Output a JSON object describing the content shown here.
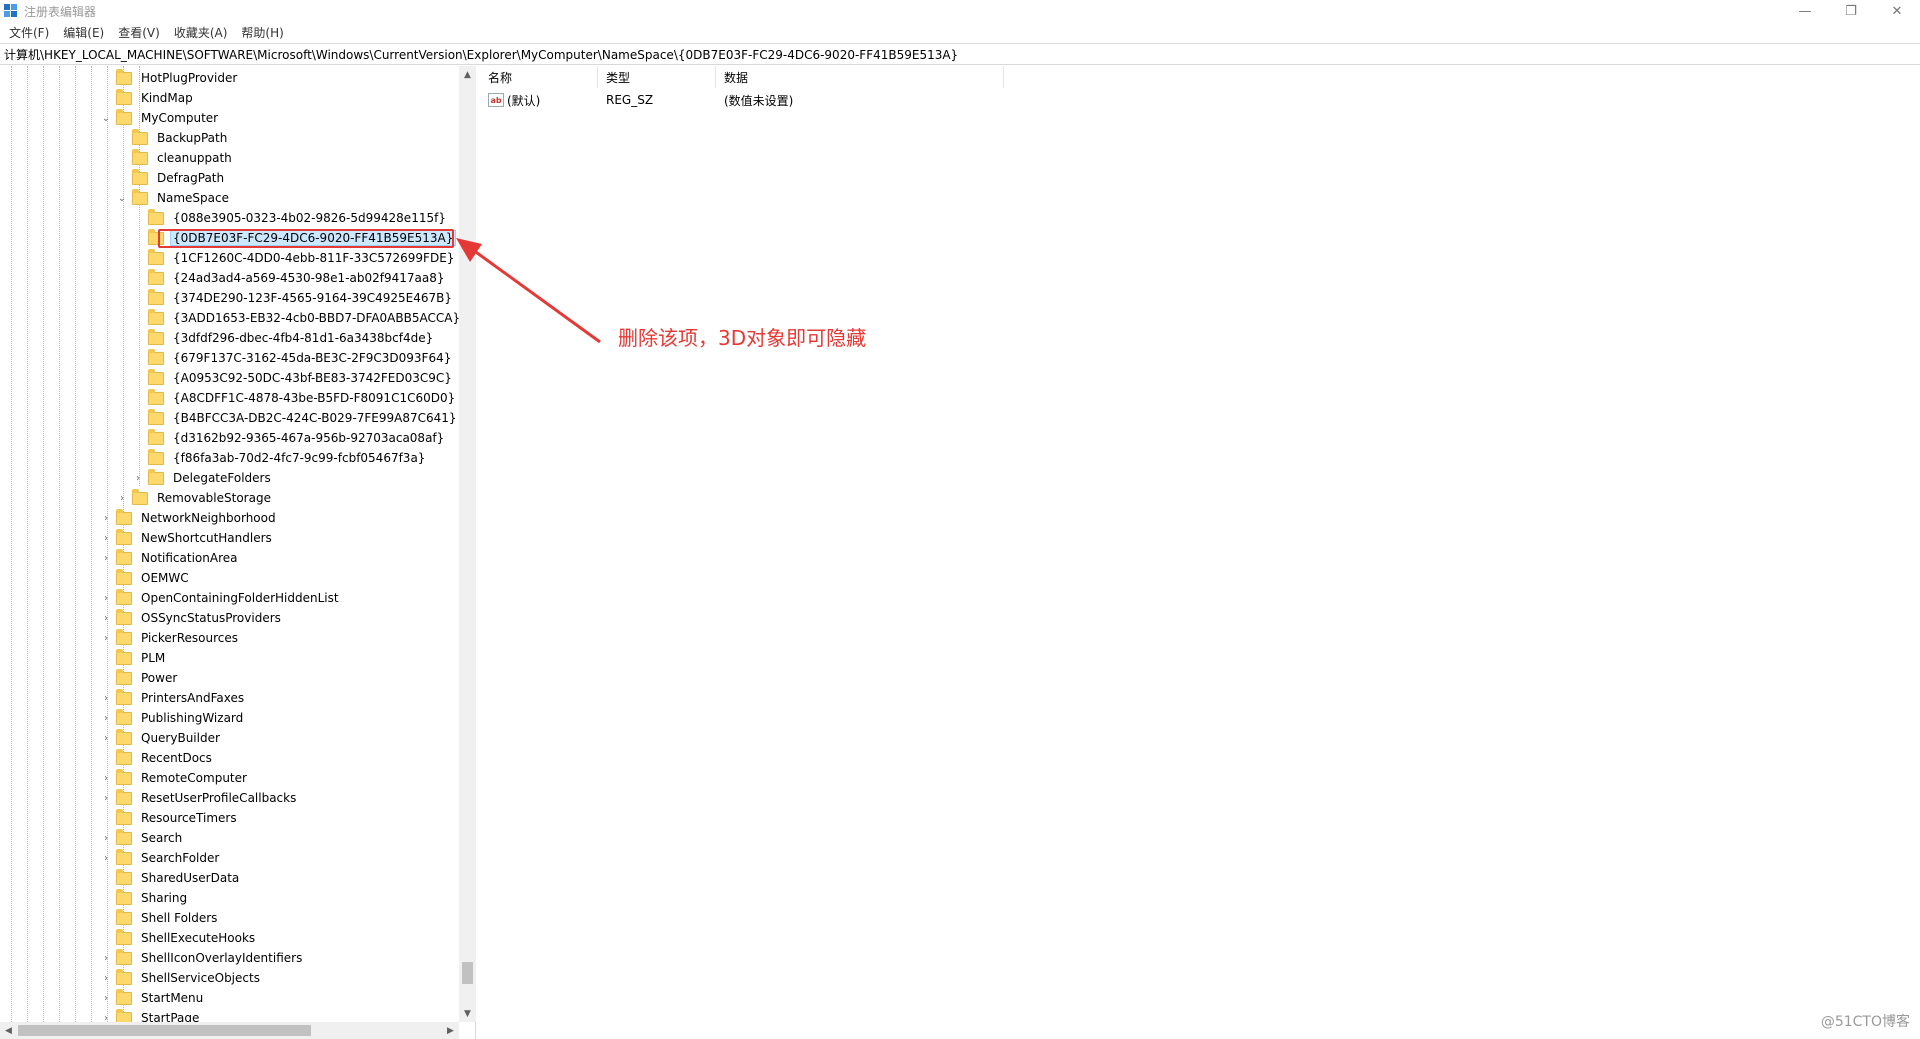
{
  "window": {
    "title": "注册表编辑器",
    "icon": "registry-editor-icon",
    "controls": {
      "minimize": "—",
      "restore": "❐",
      "close": "✕"
    }
  },
  "menu": [
    "文件(F)",
    "编辑(E)",
    "查看(V)",
    "收藏夹(A)",
    "帮助(H)"
  ],
  "address": "计算机\\HKEY_LOCAL_MACHINE\\SOFTWARE\\Microsoft\\Windows\\CurrentVersion\\Explorer\\MyComputer\\NameSpace\\{0DB7E03F-FC29-4DC6-9020-FF41B59E513A}",
  "tree": {
    "items": [
      {
        "label": "HotPlugProvider",
        "chevron": ""
      },
      {
        "label": "KindMap",
        "chevron": ""
      },
      {
        "label": "MyComputer",
        "chevron": "⌄"
      },
      {
        "label": "BackupPath",
        "chevron": ""
      },
      {
        "label": "cleanuppath",
        "chevron": ""
      },
      {
        "label": "DefragPath",
        "chevron": ""
      },
      {
        "label": "NameSpace",
        "chevron": "⌄"
      },
      {
        "label": "{088e3905-0323-4b02-9826-5d99428e115f}",
        "chevron": ""
      },
      {
        "label": "{0DB7E03F-FC29-4DC6-9020-FF41B59E513A}",
        "chevron": ""
      },
      {
        "label": "{1CF1260C-4DD0-4ebb-811F-33C572699FDE}",
        "chevron": ""
      },
      {
        "label": "{24ad3ad4-a569-4530-98e1-ab02f9417aa8}",
        "chevron": ""
      },
      {
        "label": "{374DE290-123F-4565-9164-39C4925E467B}",
        "chevron": ""
      },
      {
        "label": "{3ADD1653-EB32-4cb0-BBD7-DFA0ABB5ACCA}",
        "chevron": ""
      },
      {
        "label": "{3dfdf296-dbec-4fb4-81d1-6a3438bcf4de}",
        "chevron": ""
      },
      {
        "label": "{679F137C-3162-45da-BE3C-2F9C3D093F64}",
        "chevron": ""
      },
      {
        "label": "{A0953C92-50DC-43bf-BE83-3742FED03C9C}",
        "chevron": ""
      },
      {
        "label": "{A8CDFF1C-4878-43be-B5FD-F8091C1C60D0}",
        "chevron": ""
      },
      {
        "label": "{B4BFCC3A-DB2C-424C-B029-7FE99A87C641}",
        "chevron": ""
      },
      {
        "label": "{d3162b92-9365-467a-956b-92703aca08af}",
        "chevron": ""
      },
      {
        "label": "{f86fa3ab-70d2-4fc7-9c99-fcbf05467f3a}",
        "chevron": ""
      },
      {
        "label": "DelegateFolders",
        "chevron": "›"
      },
      {
        "label": "RemovableStorage",
        "chevron": "›"
      },
      {
        "label": "NetworkNeighborhood",
        "chevron": "›"
      },
      {
        "label": "NewShortcutHandlers",
        "chevron": "›"
      },
      {
        "label": "NotificationArea",
        "chevron": "›"
      },
      {
        "label": "OEMWC",
        "chevron": ""
      },
      {
        "label": "OpenContainingFolderHiddenList",
        "chevron": "›"
      },
      {
        "label": "OSSyncStatusProviders",
        "chevron": "›"
      },
      {
        "label": "PickerResources",
        "chevron": "›"
      },
      {
        "label": "PLM",
        "chevron": ""
      },
      {
        "label": "Power",
        "chevron": ""
      },
      {
        "label": "PrintersAndFaxes",
        "chevron": "›"
      },
      {
        "label": "PublishingWizard",
        "chevron": "›"
      },
      {
        "label": "QueryBuilder",
        "chevron": "›"
      },
      {
        "label": "RecentDocs",
        "chevron": ""
      },
      {
        "label": "RemoteComputer",
        "chevron": "›"
      },
      {
        "label": "ResetUserProfileCallbacks",
        "chevron": "›"
      },
      {
        "label": "ResourceTimers",
        "chevron": ""
      },
      {
        "label": "Search",
        "chevron": "›"
      },
      {
        "label": "SearchFolder",
        "chevron": "›"
      },
      {
        "label": "SharedUserData",
        "chevron": ""
      },
      {
        "label": "Sharing",
        "chevron": ""
      },
      {
        "label": "Shell Folders",
        "chevron": ""
      },
      {
        "label": "ShellExecuteHooks",
        "chevron": ""
      },
      {
        "label": "ShellIconOverlayIdentifiers",
        "chevron": "›"
      },
      {
        "label": "ShellServiceObjects",
        "chevron": "›"
      },
      {
        "label": "StartMenu",
        "chevron": "›"
      },
      {
        "label": "StartPage",
        "chevron": "›"
      }
    ],
    "selected_label": "{0DB7E03F-FC29-4DC6-9020-FF41B59E513A}"
  },
  "list": {
    "columns": [
      "名称",
      "类型",
      "数据"
    ],
    "rows": [
      {
        "name": "(默认)",
        "type": "REG_SZ",
        "data": "(数值未设置)",
        "icon": "ab-string-icon"
      }
    ]
  },
  "annotation": {
    "text": "删除该项，3D对象即可隐藏",
    "color": "#e53935"
  },
  "scroll_glyphs": {
    "up": "▲",
    "down": "▼",
    "left": "◀",
    "right": "▶"
  },
  "watermark": "@51CTO博客"
}
